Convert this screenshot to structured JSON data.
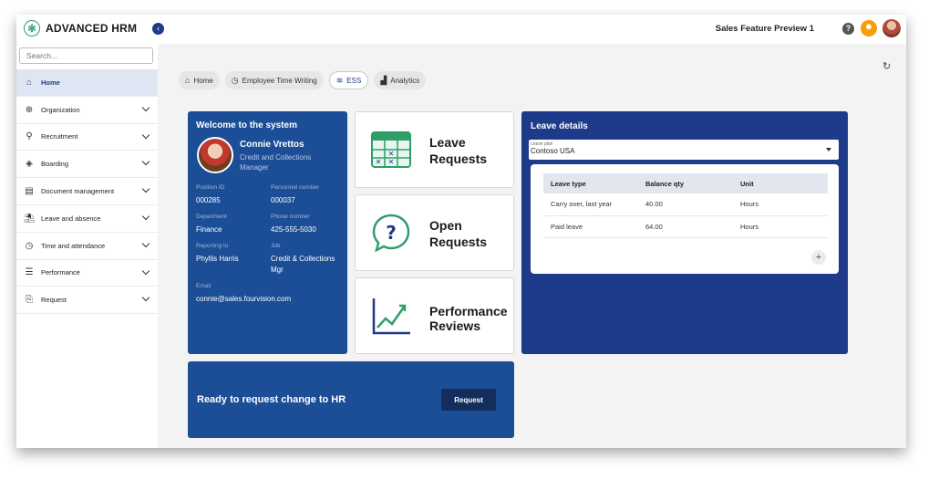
{
  "app": {
    "title": "ADVANCED HRM",
    "environment": "Sales Feature Preview 1"
  },
  "search": {
    "placeholder": "Search..."
  },
  "sidebar": {
    "items": [
      {
        "label": "Home",
        "icon": "home-icon",
        "active": true
      },
      {
        "label": "Organization",
        "icon": "globe-icon"
      },
      {
        "label": "Recruitment",
        "icon": "recruitment-icon"
      },
      {
        "label": "Boarding",
        "icon": "diamond-icon"
      },
      {
        "label": "Document management",
        "icon": "document-icon"
      },
      {
        "label": "Leave and absence",
        "icon": "beach-icon"
      },
      {
        "label": "Time and attendance",
        "icon": "clock-icon"
      },
      {
        "label": "Performance",
        "icon": "performance-icon"
      },
      {
        "label": "Request",
        "icon": "request-icon"
      }
    ]
  },
  "tabs": [
    {
      "label": "Home"
    },
    {
      "label": "Employee Time Writing"
    },
    {
      "label": "ESS",
      "active": true
    },
    {
      "label": "Analytics"
    }
  ],
  "profile": {
    "title": "Welcome to the system",
    "name": "Connie Vrettos",
    "role": "Credit and Collections Manager",
    "position_id_label": "Position ID",
    "position_id": "000285",
    "personnel_number_label": "Personnel number",
    "personnel_number": "000037",
    "department_label": "Department",
    "department": "Finance",
    "phone_label": "Phone number",
    "phone": "425-555-5030",
    "reporting_label": "Reporting to",
    "reporting": "Phyllis Harris",
    "job_label": "Job",
    "job": "Credit & Collections Mgr",
    "email_label": "Email",
    "email": "connie@sales.fourvision.com"
  },
  "tiles": {
    "leave": {
      "line1": "Leave",
      "line2": "Requests"
    },
    "open": {
      "line1": "Open",
      "line2": "Requests"
    },
    "perf": {
      "line1": "Performance",
      "line2": "Reviews"
    }
  },
  "leave_details": {
    "title": "Leave details",
    "plan_label": "Leave plan",
    "plan_value": "Contoso USA",
    "columns": [
      "Leave type",
      "Balance qty",
      "Unit"
    ],
    "rows": [
      [
        "Carry over, last year",
        "40.00",
        "Hours"
      ],
      [
        "Paid leave",
        "64.00",
        "Hours"
      ]
    ]
  },
  "banner": {
    "text": "Ready to request change to HR",
    "button": "Request"
  },
  "colors": {
    "primary": "#1e3a8a",
    "card_blue": "#1b4e96",
    "accent_green": "#2e9e6a",
    "notification": "#f59e0b"
  }
}
